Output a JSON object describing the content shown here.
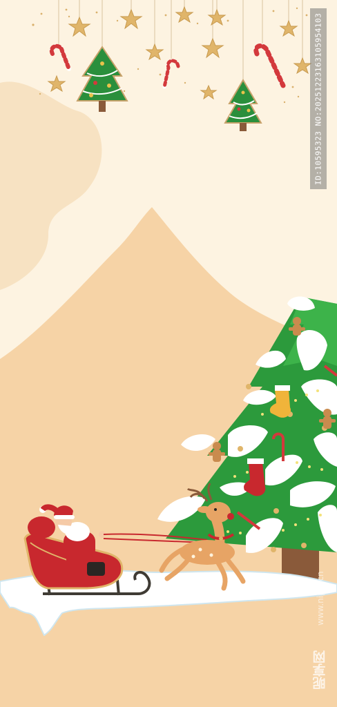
{
  "watermark": {
    "id_text": "ID:10595323 NO:20251223163105954103",
    "site_text": "www.nipic.cn",
    "brand_text": "昵享网"
  },
  "colors": {
    "background_sky": "#fdf3e1",
    "mountain": "#f6d3a6",
    "snow": "#ffffff",
    "tree_green": "#2c9a3c",
    "santa_red": "#c8282e",
    "star_gold": "#e0b56a",
    "reindeer": "#e7a465"
  }
}
